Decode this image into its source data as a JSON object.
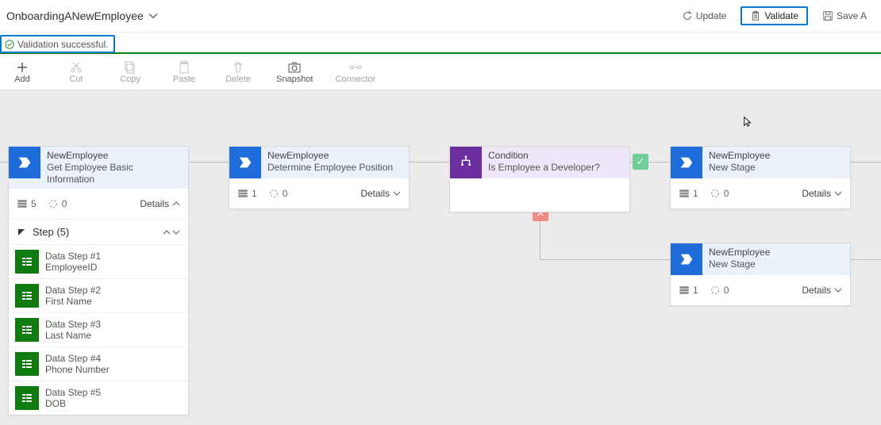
{
  "header": {
    "title": "OnboardingANewEmployee",
    "actions": {
      "update": "Update",
      "validate": "Validate",
      "save": "Save A"
    }
  },
  "messageBar": {
    "text": "Validation successful."
  },
  "toolbar": {
    "add": "Add",
    "cut": "Cut",
    "copy": "Copy",
    "paste": "Paste",
    "delete": "Delete",
    "snapshot": "Snapshot",
    "connector": "Connector"
  },
  "stages": {
    "s1": {
      "title1": "NewEmployee",
      "title2": "Get Employee Basic Information",
      "stepCount": "5",
      "cycles": "0",
      "details": "Details",
      "stepsHeader": "Step (5)",
      "steps": [
        {
          "line1": "Data Step #1",
          "line2": "EmployeeID"
        },
        {
          "line1": "Data Step #2",
          "line2": "First Name"
        },
        {
          "line1": "Data Step #3",
          "line2": "Last Name"
        },
        {
          "line1": "Data Step #4",
          "line2": "Phone Number"
        },
        {
          "line1": "Data Step #5",
          "line2": "DOB"
        }
      ]
    },
    "s2": {
      "title1": "NewEmployee",
      "title2": "Determine Employee Position",
      "stepCount": "1",
      "cycles": "0",
      "details": "Details"
    },
    "cond": {
      "title1": "Condition",
      "title2": "Is Employee a Developer?"
    },
    "s4": {
      "title1": "NewEmployee",
      "title2": "New Stage",
      "stepCount": "1",
      "cycles": "0",
      "details": "Details"
    },
    "s5": {
      "title1": "NewEmployee",
      "title2": "New Stage",
      "stepCount": "1",
      "cycles": "0",
      "details": "Details"
    }
  },
  "colors": {
    "accent": "#0078d4",
    "stageBlue": "#1f6dda",
    "conditionPurple": "#6b2fa0",
    "stepGreen": "#107c10"
  }
}
